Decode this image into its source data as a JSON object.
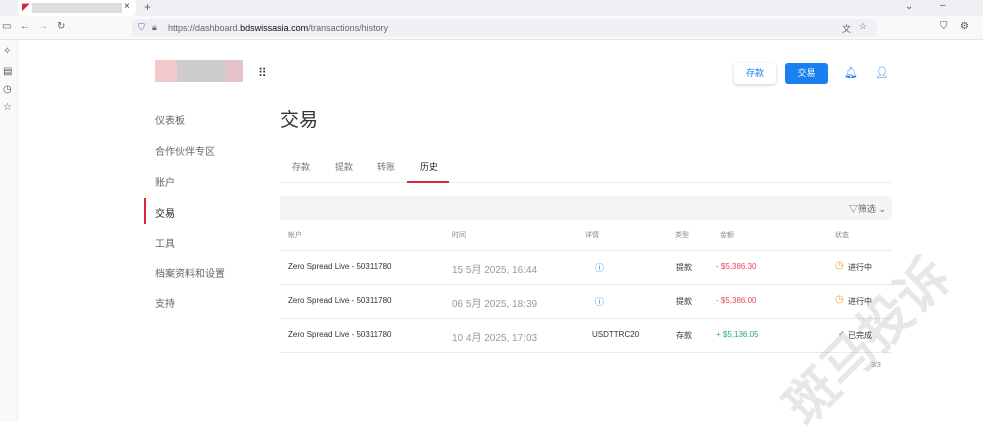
{
  "browser": {
    "url_prefix": "https://dashboard.",
    "url_domain": "bdswissasia.com",
    "url_path": "/transactions/history",
    "new_tab": "+",
    "close_tab": "×"
  },
  "header": {
    "deposit_button": "存款",
    "trade_button": "交易"
  },
  "sidebar": {
    "items": [
      {
        "label": "仪表板"
      },
      {
        "label": "合作伙伴专区"
      },
      {
        "label": "账户"
      },
      {
        "label": "交易"
      },
      {
        "label": "工具"
      },
      {
        "label": "档案资料和设置"
      },
      {
        "label": "支持"
      }
    ]
  },
  "page": {
    "title": "交易",
    "tabs": [
      {
        "label": "存款"
      },
      {
        "label": "提款"
      },
      {
        "label": "转账"
      },
      {
        "label": "历史"
      }
    ],
    "filter_label": "筛选"
  },
  "table": {
    "headers": [
      "帐户",
      "时间",
      "详情",
      "类型",
      "金额",
      "状态"
    ],
    "rows": [
      {
        "account": "Zero Spread Live - 50311780",
        "time": "15 5月 2025, 16:44",
        "details": "",
        "type": "提款",
        "amount": "- $5,386.30",
        "status": "进行中"
      },
      {
        "account": "Zero Spread Live - 50311780",
        "time": "06 5月 2025, 18:39",
        "details": "",
        "type": "提款",
        "amount": "- $5,386.00",
        "status": "进行中"
      },
      {
        "account": "Zero Spread Live - 50311780",
        "time": "10 4月 2025, 17:03",
        "details": "USDTTRC20",
        "type": "存款",
        "amount": "+ $5,136.05",
        "status": "已完成"
      }
    ],
    "pagination": "3/3"
  },
  "watermark": "斑马投诉",
  "colors": {
    "accent": "#1a7ff0",
    "active": "#d9263b",
    "negative": "#e0485a",
    "positive": "#2aa876",
    "pending": "#f0a030"
  }
}
